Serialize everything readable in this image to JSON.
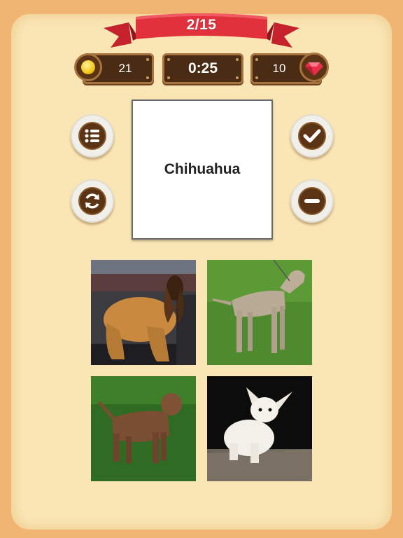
{
  "progress": {
    "label": "2/15",
    "current": 2,
    "total": 15
  },
  "stats": {
    "coins": "21",
    "timer": "0:25",
    "gems": "10"
  },
  "buttons": {
    "menu": "list-icon",
    "restart": "refresh-icon",
    "confirm": "check-icon",
    "remove": "minus-icon"
  },
  "question": {
    "word": "Chihuahua"
  },
  "answers": [
    {
      "id": "afghan-hound-photo"
    },
    {
      "id": "weimaraner-photo"
    },
    {
      "id": "border-terrier-photo"
    },
    {
      "id": "chihuahua-photo"
    }
  ],
  "colors": {
    "ribbon": "#e0313d",
    "wood": "#4a2c14",
    "panel": "#fae6b4",
    "background": "#efb571"
  }
}
